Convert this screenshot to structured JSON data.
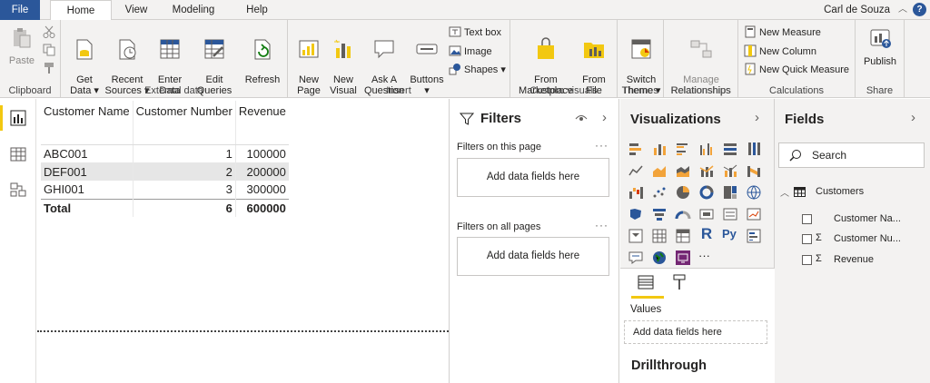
{
  "tabs": {
    "file": "File",
    "home": "Home",
    "view": "View",
    "modeling": "Modeling",
    "help": "Help"
  },
  "user": "Carl de Souza",
  "ribbon": {
    "clipboard": {
      "label": "Clipboard",
      "paste": "Paste"
    },
    "external": {
      "label": "External data",
      "get_data": "Get\nData ▾",
      "recent": "Recent\nSources ▾",
      "enter": "Enter\nData",
      "edit": "Edit\nQueries ▾",
      "refresh": "Refresh"
    },
    "insert": {
      "label": "Insert",
      "new_page": "New\nPage ▾",
      "new_visual": "New\nVisual",
      "ask": "Ask A\nQuestion",
      "buttons": "Buttons\n▾",
      "text_box": "Text box",
      "image": "Image",
      "shapes": "Shapes ▾"
    },
    "custom": {
      "label": "Custom visuals",
      "marketplace": "From\nMarketplace",
      "file": "From\nFile"
    },
    "themes": {
      "label": "Themes",
      "switch": "Switch\nTheme ▾"
    },
    "relationships": {
      "label": "Relationships",
      "manage": "Manage\nRelationships"
    },
    "calculations": {
      "label": "Calculations",
      "new_measure": "New Measure",
      "new_column": "New Column",
      "new_quick": "New Quick Measure"
    },
    "share": {
      "label": "Share",
      "publish": "Publish"
    }
  },
  "table": {
    "headers": [
      "Customer Name",
      "Customer Number",
      "Revenue"
    ],
    "rows": [
      {
        "name": "ABC001",
        "number": "1",
        "revenue": "100000"
      },
      {
        "name": "DEF001",
        "number": "2",
        "revenue": "200000"
      },
      {
        "name": "GHI001",
        "number": "3",
        "revenue": "300000"
      }
    ],
    "total": {
      "label": "Total",
      "number": "6",
      "revenue": "600000"
    }
  },
  "filters": {
    "title": "Filters",
    "this_page": "Filters on this page",
    "all_pages": "Filters on all pages",
    "add": "Add data fields here",
    "dots": "···"
  },
  "visualizations": {
    "title": "Visualizations",
    "values_label": "Values",
    "values_placeholder": "Add data fields here",
    "drillthrough": "Drillthrough",
    "more": "···"
  },
  "fields": {
    "title": "Fields",
    "search_placeholder": "Search",
    "table_name": "Customers",
    "items": [
      {
        "name": "Customer Na...",
        "sigma": ""
      },
      {
        "name": "Customer Nu...",
        "sigma": "Σ"
      },
      {
        "name": "Revenue",
        "sigma": "Σ"
      }
    ]
  },
  "colors": {
    "accent": "#f2c811",
    "file_tab": "#2b579a",
    "ribbon_bg": "#f3f2f1"
  }
}
